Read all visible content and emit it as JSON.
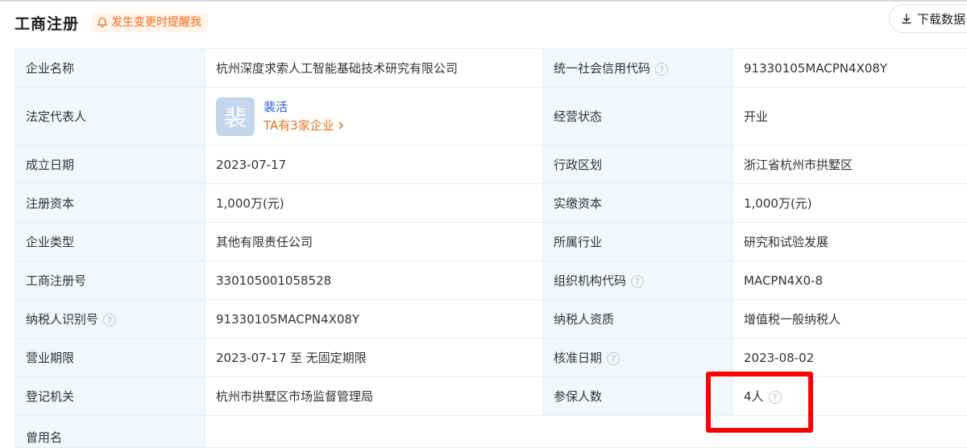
{
  "header": {
    "title": "工商注册",
    "alert_label": "发生变更时提醒我",
    "download_label": "下载数据"
  },
  "rows": [
    {
      "label1": "企业名称",
      "value1": "杭州深度求索人工智能基础技术研究有限公司",
      "label2": "统一社会信用代码",
      "value2": "91330105MACPN4X08Y"
    },
    {
      "label1": "法定代表人",
      "rep_avatar": "裴",
      "rep_name": "裴活",
      "rep_link": "TA有3家企业",
      "label2": "经营状态",
      "value2": "开业"
    },
    {
      "label1": "成立日期",
      "value1": "2023-07-17",
      "label2": "行政区划",
      "value2": "浙江省杭州市拱墅区"
    },
    {
      "label1": "注册资本",
      "value1": "1,000万(元)",
      "label2": "实缴资本",
      "value2": "1,000万(元)"
    },
    {
      "label1": "企业类型",
      "value1": "其他有限责任公司",
      "label2": "所属行业",
      "value2": "研究和试验发展"
    },
    {
      "label1": "工商注册号",
      "value1": "330105001058528",
      "label2": "组织机构代码",
      "value2": "MACPN4X0-8"
    },
    {
      "label1": "纳税人识别号",
      "value1": "91330105MACPN4X08Y",
      "label2": "纳税人资质",
      "value2": "增值税一般纳税人"
    },
    {
      "label1": "营业期限",
      "value1": "2023-07-17 至 无固定期限",
      "label2": "核准日期",
      "value2": "2023-08-02"
    },
    {
      "label1": "登记机关",
      "value1": "杭州市拱墅区市场监督管理局",
      "label2": "参保人数",
      "value2": "4人"
    },
    {
      "label1": "曾用名"
    }
  ],
  "help_glyph": "?",
  "colors": {
    "accent_orange": "#f06c1e",
    "link_blue": "#2c5ad6",
    "label_bg": "#f3f6fb",
    "highlight_red": "#ff0000"
  }
}
